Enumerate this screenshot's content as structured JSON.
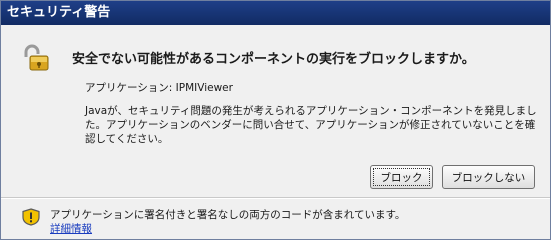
{
  "window": {
    "title": "セキュリティ警告"
  },
  "dialog": {
    "headline": "安全でない可能性があるコンポーネントの実行をブロックしますか。",
    "application_line": "アプリケーション: IPMIViewer",
    "description": "Javaが、セキュリティ問題の発生が考えられるアプリケーション・コンポーネントを発見しました。アプリケーションのベンダーに問い合せて、アプリケーションが修正されていないことを確認してください。",
    "icons": {
      "main": "lock-icon",
      "footer": "warning-shield-icon"
    }
  },
  "buttons": {
    "block_label": "ブロック",
    "dont_block_label": "ブロックしない"
  },
  "footer": {
    "message": "アプリケーションに署名付きと署名なしの両方のコードが含まれています。",
    "link_label": "詳細情報"
  },
  "colors": {
    "titlebar": "#173474",
    "window_bg": "#f0f0f0",
    "link": "#1a3dbf",
    "lock_gold": "#d9a520"
  }
}
